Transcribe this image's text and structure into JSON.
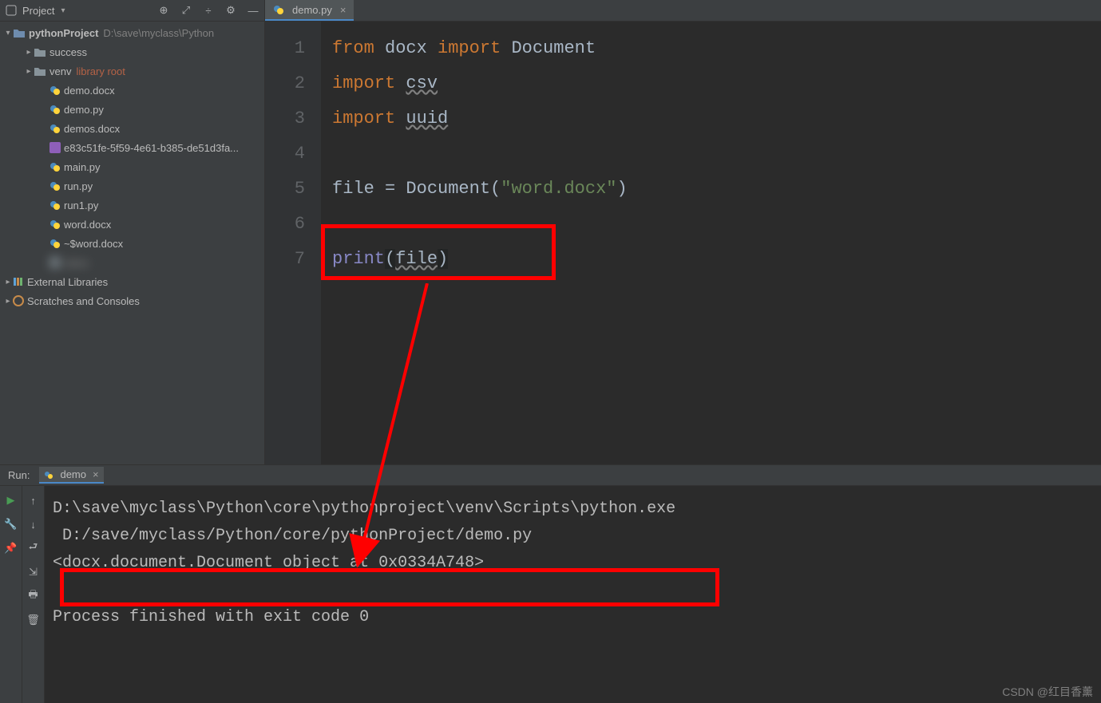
{
  "project_panel": {
    "title": "Project",
    "toolbar_icons": [
      "target-icon",
      "collapse-icon",
      "gear-icon",
      "hide-icon"
    ]
  },
  "tree": {
    "root": {
      "name": "pythonProject",
      "path": "D:\\save\\myclass\\Python"
    },
    "folders": [
      {
        "name": "success",
        "note": ""
      },
      {
        "name": "venv",
        "note": "library root"
      }
    ],
    "files": [
      {
        "name": "demo.docx",
        "type": "doc"
      },
      {
        "name": "demo.py",
        "type": "py"
      },
      {
        "name": "demos.docx",
        "type": "doc"
      },
      {
        "name": "e83c51fe-5f59-4e61-b385-de51d3fa...",
        "type": "csv"
      },
      {
        "name": "main.py",
        "type": "py"
      },
      {
        "name": "run.py",
        "type": "py"
      },
      {
        "name": "run1.py",
        "type": "py"
      },
      {
        "name": "word.docx",
        "type": "doc"
      },
      {
        "name": "~$word.docx",
        "type": "doc"
      }
    ],
    "ext_nodes": [
      {
        "name": "External Libraries"
      },
      {
        "name": "Scratches and Consoles"
      }
    ]
  },
  "editor": {
    "tab": "demo.py",
    "lines": [
      "1",
      "2",
      "3",
      "4",
      "5",
      "6",
      "7"
    ],
    "code": {
      "l1_from": "from",
      "l1_mod": "docx",
      "l1_import": "import",
      "l1_name": "Document",
      "l2": "import csv",
      "l3": "import uuid",
      "l5_a": "file = ",
      "l5_fn": "Document",
      "l5_p1": "(",
      "l5_str": "\"word.docx\"",
      "l5_p2": ")",
      "l7_fn": "print",
      "l7_p1": "(",
      "l7_arg": "file",
      "l7_p2": ")"
    }
  },
  "run": {
    "label": "Run:",
    "program": "demo",
    "output": {
      "l1": "D:\\save\\myclass\\Python\\core\\pythonproject\\venv\\Scripts\\python.exe",
      "l2": " D:/save/myclass/Python/core/pythonProject/demo.py",
      "l3": "<docx.document.Document object at 0x0334A748>",
      "l4": "",
      "l5": "Process finished with exit code 0"
    }
  },
  "watermark": "CSDN @红目香薰"
}
